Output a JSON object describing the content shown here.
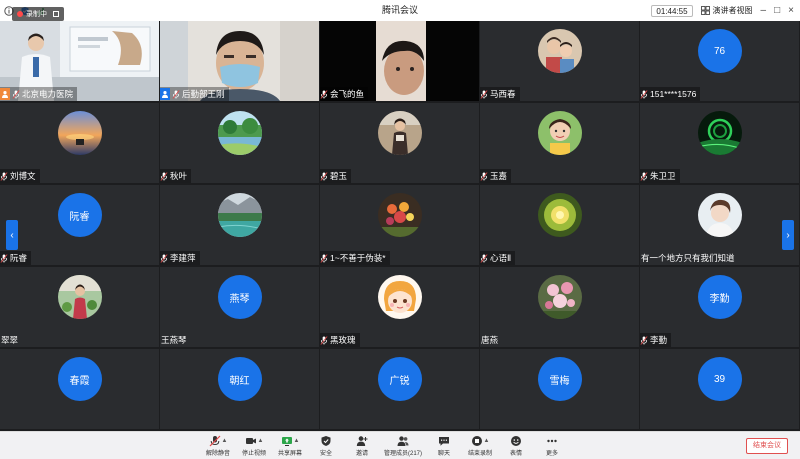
{
  "window": {
    "title": "腾讯会议",
    "timer": "01:44:55",
    "view_label": "演讲者视图"
  },
  "recording": {
    "label": "录制中"
  },
  "participants": [
    {
      "name": "北京电力医院",
      "type": "video",
      "badge": "host"
    },
    {
      "name": "后勤部王刚",
      "type": "video",
      "badge": "user"
    },
    {
      "name": "会飞的鱼",
      "type": "video"
    },
    {
      "name": "马西春",
      "type": "photo",
      "photo": "p-couple"
    },
    {
      "name": "151****1576",
      "type": "text",
      "avatar_text": "76"
    },
    {
      "name": "刘博文",
      "type": "photo",
      "photo": "p-sunset"
    },
    {
      "name": "秋叶",
      "type": "photo",
      "photo": "p-lake"
    },
    {
      "name": "碧玉",
      "type": "photo",
      "photo": "p-woman"
    },
    {
      "name": "玉嘉",
      "type": "photo",
      "photo": "p-face"
    },
    {
      "name": "朱卫卫",
      "type": "photo",
      "photo": "p-green"
    },
    {
      "name": "阮睿",
      "type": "text",
      "avatar_text": "阮睿"
    },
    {
      "name": "李建萍",
      "type": "photo",
      "photo": "p-river"
    },
    {
      "name": "1~不善于伪装*",
      "type": "photo",
      "photo": "p-flower"
    },
    {
      "name": "心语Ⅱ",
      "type": "photo",
      "photo": "p-yellow"
    },
    {
      "name": "有一个地方只有我们知道",
      "type": "photo",
      "photo": "p-man",
      "plain": true
    },
    {
      "name": "翠翠",
      "type": "photo",
      "photo": "p-garden",
      "plain": true
    },
    {
      "name": "王燕琴",
      "type": "text",
      "avatar_text": "燕琴",
      "plain": true
    },
    {
      "name": "黑玫瑰",
      "type": "photo",
      "photo": "p-cartoon"
    },
    {
      "name": "唐燕",
      "type": "photo",
      "photo": "p-roses",
      "plain": true
    },
    {
      "name": "李勤",
      "type": "text",
      "avatar_text": "李勤"
    },
    {
      "name": "",
      "type": "text",
      "avatar_text": "春霞"
    },
    {
      "name": "",
      "type": "text",
      "avatar_text": "朝红"
    },
    {
      "name": "",
      "type": "text",
      "avatar_text": "广锐"
    },
    {
      "name": "",
      "type": "text",
      "avatar_text": "雪梅"
    },
    {
      "name": "",
      "type": "text",
      "avatar_text": "39"
    }
  ],
  "toolbar": {
    "items": [
      {
        "label": "解除静音",
        "icon": "mic-muted-icon",
        "caret": true
      },
      {
        "label": "停止视频",
        "icon": "video-icon",
        "caret": true
      },
      {
        "label": "共享屏幕",
        "icon": "share-screen-icon",
        "caret": true
      },
      {
        "label": "安全",
        "icon": "shield-icon"
      },
      {
        "label": "邀请",
        "icon": "invite-icon"
      },
      {
        "label": "管理成员(217)",
        "icon": "members-icon",
        "wide": true
      },
      {
        "label": "聊天",
        "icon": "chat-icon"
      },
      {
        "label": "结束录制",
        "icon": "record-stop-icon",
        "caret": true
      },
      {
        "label": "表情",
        "icon": "emoji-icon"
      },
      {
        "label": "更多",
        "icon": "more-icon"
      }
    ],
    "end_label": "结束会议"
  },
  "colors": {
    "accent": "#1a73e8",
    "tile": "#2a2c2f",
    "background": "#1c1d1f",
    "danger": "#e05050"
  }
}
